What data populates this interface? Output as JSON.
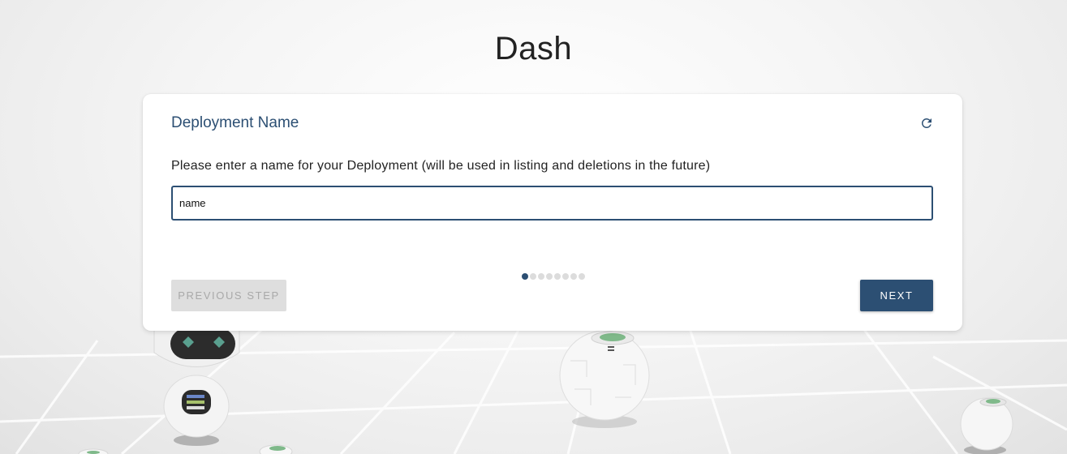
{
  "page": {
    "title": "Dash"
  },
  "card": {
    "title": "Deployment Name",
    "instruction": "Please enter a name for your Deployment (will be used in listing and deletions in the future)",
    "input": {
      "value": "name",
      "placeholder": ""
    },
    "stepper": {
      "total_steps": 8,
      "current_step": 1
    },
    "buttons": {
      "previous_label": "PREVIOUS STEP",
      "next_label": "NEXT"
    }
  },
  "colors": {
    "accent": "#2c4f73",
    "disabled_bg": "#dedede",
    "disabled_text": "#a9a9a9"
  },
  "icons": {
    "refresh": "refresh-icon"
  }
}
